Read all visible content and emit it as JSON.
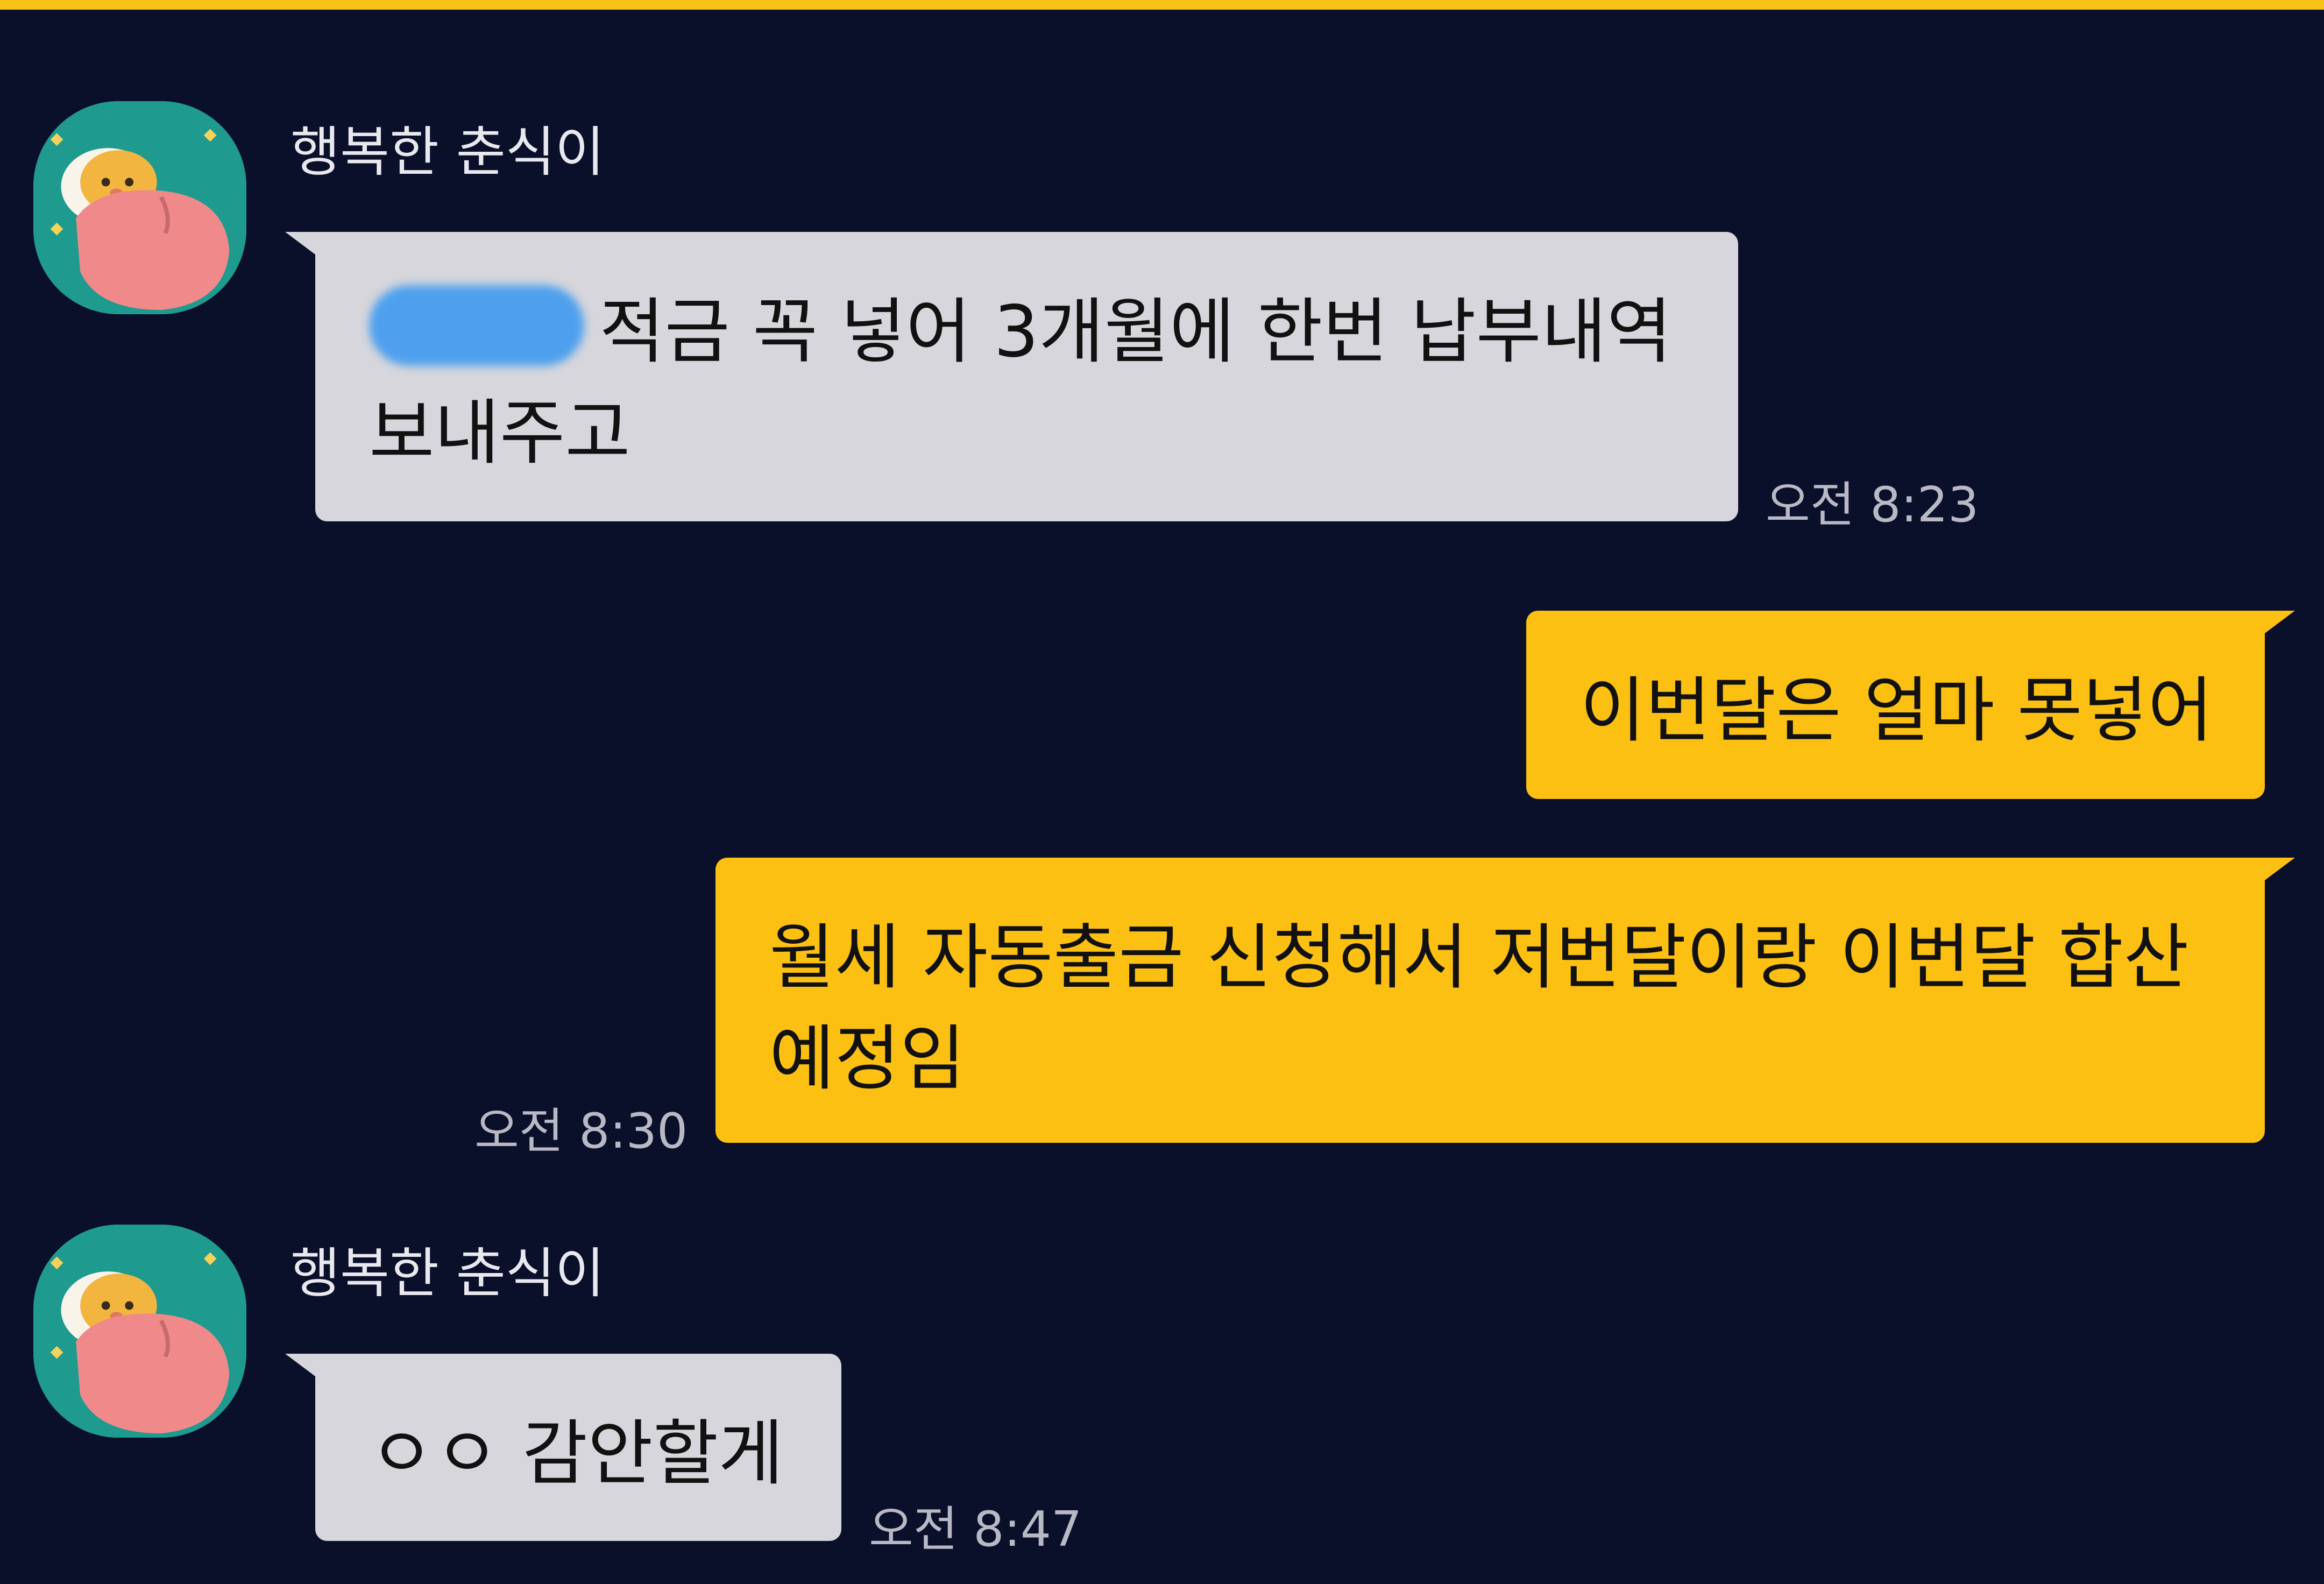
{
  "chat": {
    "messages": [
      {
        "direction": "incoming",
        "sender": "행복한 춘식이",
        "redacted_prefix": true,
        "lines": [
          "적금 꼭 넣어 3개월에 한번 납부내역",
          "보내주고"
        ],
        "time": "오전 8:23"
      },
      {
        "direction": "outgoing",
        "lines": [
          "이번달은 얼마 못넣어"
        ]
      },
      {
        "direction": "outgoing",
        "lines": [
          "월세 자동출금 신청해서 저번달이랑 이번달 합산",
          "예정임"
        ],
        "time": "오전 8:30"
      },
      {
        "direction": "incoming",
        "sender": "행복한 춘식이",
        "lines": [
          "ㅇㅇ 감안할게"
        ],
        "time": "오전 8:47"
      }
    ]
  },
  "colors": {
    "background": "#0a0f2a",
    "incoming_bubble": "#d6d6dc",
    "outgoing_bubble": "#fbc011",
    "accent_bar": "#f6c218",
    "redaction": "#4ea0ee"
  },
  "icons": {
    "avatar": "choonsik-sleeping-avatar-icon"
  }
}
